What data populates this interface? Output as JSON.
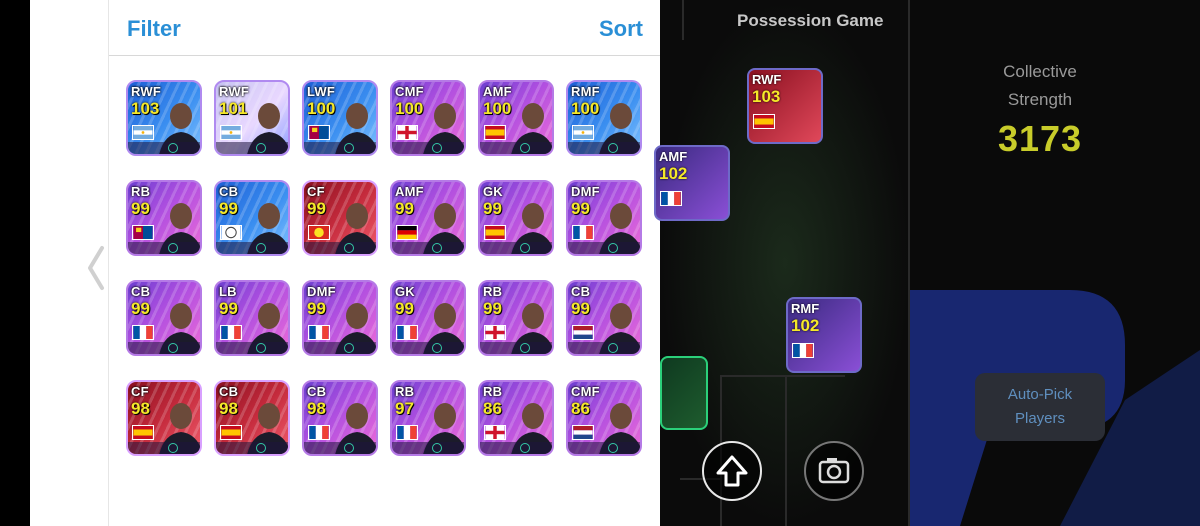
{
  "header": {
    "filter_label": "Filter",
    "sort_label": "Sort"
  },
  "players": [
    {
      "pos": "RWF",
      "rating": "103",
      "flag": "argentina",
      "style": "blue"
    },
    {
      "pos": "RWF",
      "rating": "101",
      "flag": "argentina",
      "style": "light"
    },
    {
      "pos": "LWF",
      "rating": "100",
      "flag": "barcelona-crest",
      "style": "blue"
    },
    {
      "pos": "CMF",
      "rating": "100",
      "flag": "england",
      "style": "purple"
    },
    {
      "pos": "AMF",
      "rating": "100",
      "flag": "spain",
      "style": "purple"
    },
    {
      "pos": "RMF",
      "rating": "100",
      "flag": "argentina",
      "style": "blue"
    },
    {
      "pos": "RB",
      "rating": "99",
      "flag": "barcelona-crest",
      "style": "purple"
    },
    {
      "pos": "CB",
      "rating": "99",
      "flag": "club-crest",
      "style": "blue"
    },
    {
      "pos": "CF",
      "rating": "99",
      "flag": "man-utd-crest",
      "style": "red"
    },
    {
      "pos": "AMF",
      "rating": "99",
      "flag": "germany",
      "style": "purple"
    },
    {
      "pos": "GK",
      "rating": "99",
      "flag": "spain",
      "style": "purple"
    },
    {
      "pos": "DMF",
      "rating": "99",
      "flag": "france",
      "style": "purple"
    },
    {
      "pos": "CB",
      "rating": "99",
      "flag": "france",
      "style": "purple"
    },
    {
      "pos": "LB",
      "rating": "99",
      "flag": "france",
      "style": "purple"
    },
    {
      "pos": "DMF",
      "rating": "99",
      "flag": "france",
      "style": "purple"
    },
    {
      "pos": "GK",
      "rating": "99",
      "flag": "france",
      "style": "purple"
    },
    {
      "pos": "RB",
      "rating": "99",
      "flag": "england",
      "style": "purple"
    },
    {
      "pos": "CB",
      "rating": "99",
      "flag": "netherlands",
      "style": "purple"
    },
    {
      "pos": "CF",
      "rating": "98",
      "flag": "spain",
      "style": "red"
    },
    {
      "pos": "CB",
      "rating": "98",
      "flag": "spain",
      "style": "red"
    },
    {
      "pos": "CB",
      "rating": "98",
      "flag": "france",
      "style": "purple"
    },
    {
      "pos": "RB",
      "rating": "97",
      "flag": "france",
      "style": "purple"
    },
    {
      "pos": "RB",
      "rating": "86",
      "flag": "england",
      "style": "purple"
    },
    {
      "pos": "CMF",
      "rating": "86",
      "flag": "netherlands",
      "style": "purple"
    }
  ],
  "game": {
    "mode_title": "Possession Game",
    "collective_label_line1": "Collective",
    "collective_label_line2": "Strength",
    "collective_value": "3173",
    "auto_pick_line1": "Auto-Pick",
    "auto_pick_line2": "Players"
  },
  "field_players": [
    {
      "pos": "RWF",
      "rating": "103",
      "flag": "spain"
    },
    {
      "pos": "AMF",
      "rating": "102",
      "flag": "france"
    },
    {
      "pos": "RMF",
      "rating": "102",
      "flag": "france"
    }
  ],
  "colors": {
    "accent_blue": "#2a8fd6",
    "rating_yellow": "#f5e829",
    "strength_yellow": "#c8cc2a"
  }
}
